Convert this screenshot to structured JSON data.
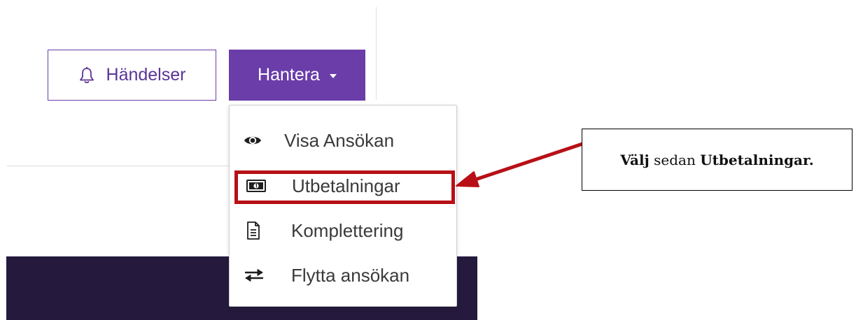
{
  "header": {
    "events_button_label": "Händelser",
    "manage_button_label": "Hantera"
  },
  "menu": {
    "items": [
      {
        "label": "Visa Ansökan",
        "icon": "eye-icon"
      },
      {
        "label": "Utbetalningar",
        "icon": "money-bill-icon"
      },
      {
        "label": "Komplettering",
        "icon": "document-icon"
      },
      {
        "label": "Flytta ansökan",
        "icon": "transfer-arrows-icon"
      }
    ]
  },
  "callout": {
    "part1_bold": "Välj",
    "part2": " sedan ",
    "part3_bold": "Utbetalningar."
  },
  "colors": {
    "brand_purple": "#6a3da9",
    "highlight_red": "#b80f16",
    "footer_dark": "#251a3d"
  }
}
